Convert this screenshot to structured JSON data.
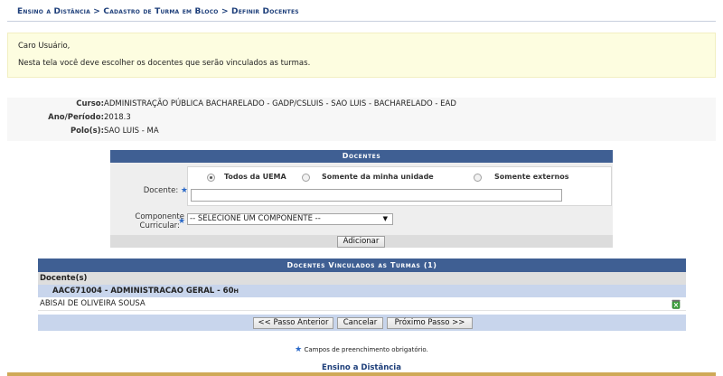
{
  "breadcrumb": {
    "items": [
      "Ensino a Distância",
      "Cadastro de Turma em Bloco",
      "Definir Docentes"
    ],
    "separator": ">"
  },
  "notice": {
    "greeting": "Caro Usuário,",
    "message": "Nesta tela você deve escolher os docentes que serão vinculados as turmas."
  },
  "info": {
    "curso_label": "Curso:",
    "curso_value": "ADMINISTRAÇÃO PÚBLICA BACHARELADO - GADP/CSLUIS - SAO LUIS - BACHARELADO - EAD",
    "periodo_label": "Ano/Período:",
    "periodo_value": "2018.3",
    "polo_label": "Polo(s):",
    "polo_value": "SAO LUIS - MA"
  },
  "form": {
    "title": "Docentes",
    "docente_label": "Docente:",
    "radios": [
      {
        "label": "Todos da UEMA",
        "selected": true
      },
      {
        "label": "Somente da minha unidade",
        "selected": false
      },
      {
        "label": "Somente externos",
        "selected": false
      }
    ],
    "docente_value": "",
    "componente_label_line1": "Componente",
    "componente_label_line2": "Curricular:",
    "componente_selected": "-- SELECIONE UM COMPONENTE --",
    "add_button": "Adicionar",
    "required_star": "★"
  },
  "table": {
    "title": "Docentes Vinculados as Turmas (1)",
    "column_header": "Docente(s)",
    "group_label": "AAC671004 - ADMINISTRACAO GERAL - 60",
    "group_suffix": "H",
    "rows": [
      {
        "name": "ABISAI DE OLIVEIRA SOUSA",
        "action_icon": "remove-icon"
      }
    ],
    "nav_buttons": {
      "previous": "<< Passo Anterior",
      "cancel": "Cancelar",
      "next": "Próximo Passo >>"
    }
  },
  "required_note": "Campos de preenchimento obrigatório.",
  "footer": "Ensino a Distância",
  "colors": {
    "header_blue": "#3f5f93",
    "link_blue": "#1e3f7a",
    "row_blue": "#c8d5ec",
    "notice_bg": "#fdfde0",
    "footer_gold": "#cfa957"
  }
}
